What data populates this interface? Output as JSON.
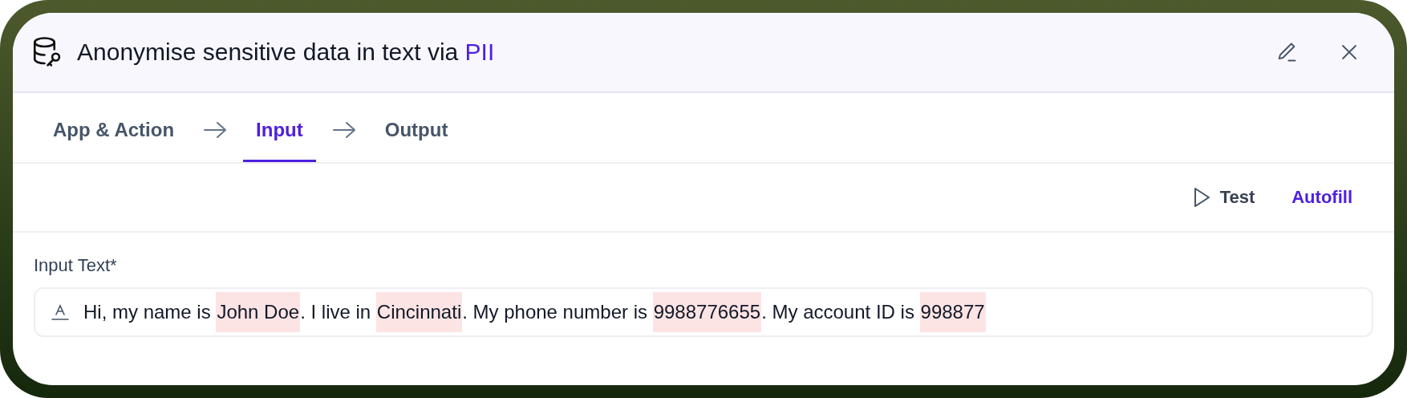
{
  "header": {
    "title": "Anonymise sensitive data in text via",
    "app": "PII"
  },
  "tabs": [
    {
      "label": "App & Action",
      "selected": false
    },
    {
      "label": "Input",
      "selected": true
    },
    {
      "label": "Output",
      "selected": false
    }
  ],
  "toolbar": {
    "test": "Test",
    "autofill": "Autofill"
  },
  "field": {
    "label": "Input Text*",
    "segments": [
      {
        "text": "Hi, my name is ",
        "highlighted": false
      },
      {
        "text": "John Doe",
        "highlighted": true
      },
      {
        "text": ". I live in ",
        "highlighted": false
      },
      {
        "text": "Cincinnati",
        "highlighted": true
      },
      {
        "text": ". My phone number is ",
        "highlighted": false
      },
      {
        "text": "9988776655",
        "highlighted": true
      },
      {
        "text": ". My account ID is ",
        "highlighted": false
      },
      {
        "text": "998877",
        "highlighted": true
      }
    ]
  }
}
